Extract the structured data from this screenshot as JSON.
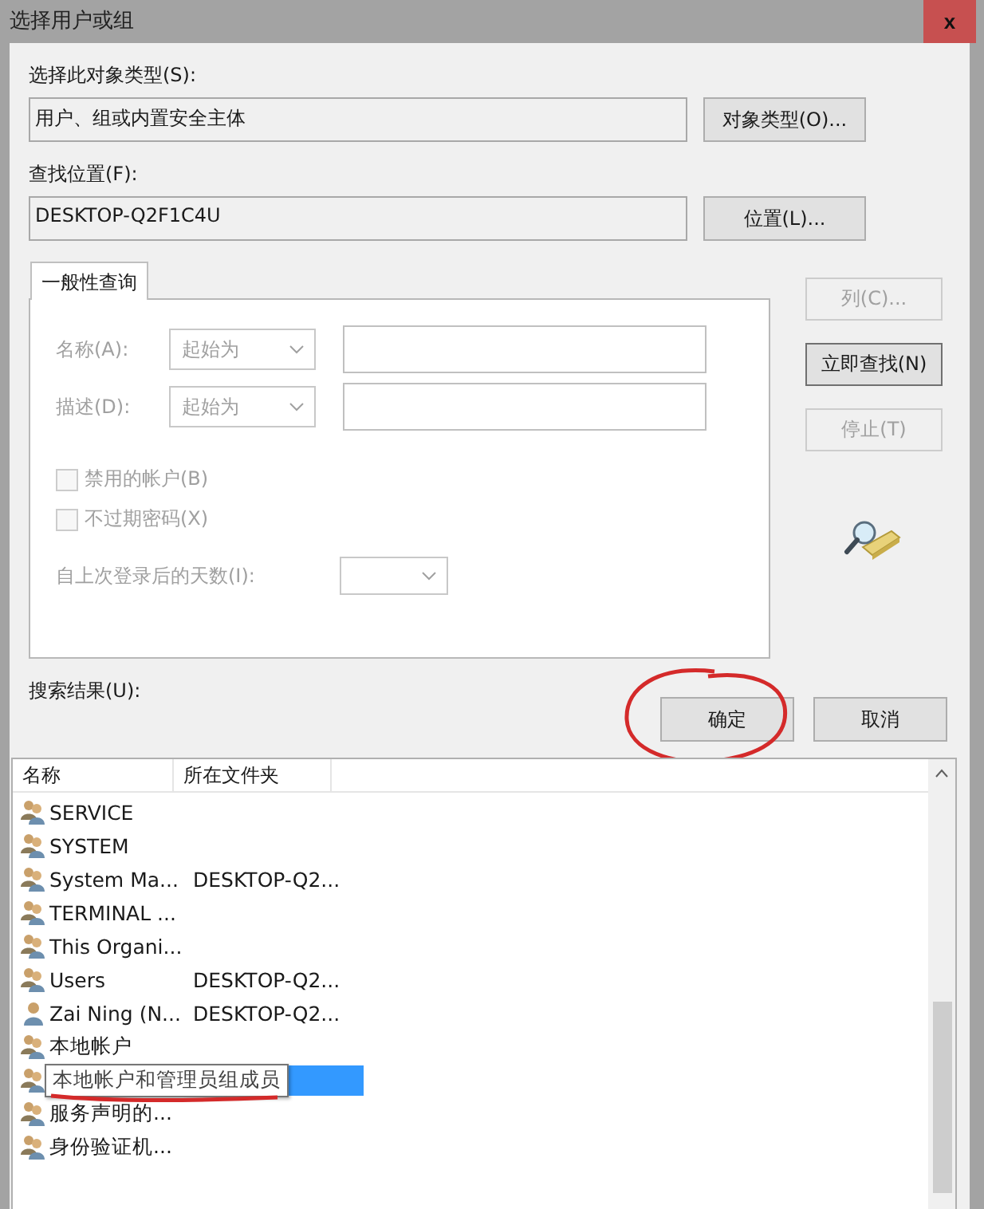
{
  "window": {
    "title": "选择用户或组",
    "close": "x"
  },
  "object_type": {
    "label": "选择此对象类型(S):",
    "value": "用户、组或内置安全主体",
    "button": "对象类型(O)..."
  },
  "location": {
    "label": "查找位置(F):",
    "value": "DESKTOP-Q2F1C4U",
    "button": "位置(L)..."
  },
  "tabs": [
    {
      "label": "一般性查询",
      "selected": true
    }
  ],
  "query": {
    "rows": [
      {
        "label": "名称(A):",
        "combo": "起始为",
        "disabled": true
      },
      {
        "label": "描述(D):",
        "combo": "起始为",
        "disabled": true
      }
    ],
    "checkboxes": [
      {
        "label": "禁用的帐户(B)",
        "checked": false,
        "disabled": true
      },
      {
        "label": "不过期密码(X)",
        "checked": false,
        "disabled": true
      }
    ],
    "days_label": "自上次登录后的天数(I):"
  },
  "side_buttons": [
    {
      "label": "列(C)...",
      "disabled": true
    },
    {
      "label": "立即查找(N)",
      "disabled": false
    },
    {
      "label": "停止(T)",
      "disabled": true
    }
  ],
  "dialog_buttons": [
    {
      "label": "确定",
      "annotated": true
    },
    {
      "label": "取消",
      "annotated": false
    }
  ],
  "results": {
    "label": "搜索结果(U):",
    "columns": [
      "名称",
      "所在文件夹"
    ],
    "rows": [
      {
        "kind": "group",
        "name": "SERVICE",
        "selected": false
      },
      {
        "kind": "group",
        "name": "SYSTEM",
        "selected": false
      },
      {
        "kind": "group",
        "name": "System Ma...",
        "folder": "DESKTOP-Q2...",
        "selected": false
      },
      {
        "kind": "group",
        "name": "TERMINAL ...",
        "selected": false
      },
      {
        "kind": "group",
        "name": "This Organi...",
        "selected": false
      },
      {
        "kind": "group",
        "name": "Users",
        "folder": "DESKTOP-Q2...",
        "selected": false
      },
      {
        "kind": "user",
        "name": "Zai Ning (N...",
        "folder": "DESKTOP-Q2...",
        "selected": false
      },
      {
        "kind": "group",
        "name": "本地帐户",
        "selected": false
      },
      {
        "kind": "group",
        "tooltip": "本地帐户和管理员组成员",
        "annotated": true,
        "selected": true
      },
      {
        "kind": "group",
        "name": "服务声明的...",
        "selected": false
      },
      {
        "kind": "group",
        "name": "身份验证机...",
        "selected": false
      }
    ]
  }
}
